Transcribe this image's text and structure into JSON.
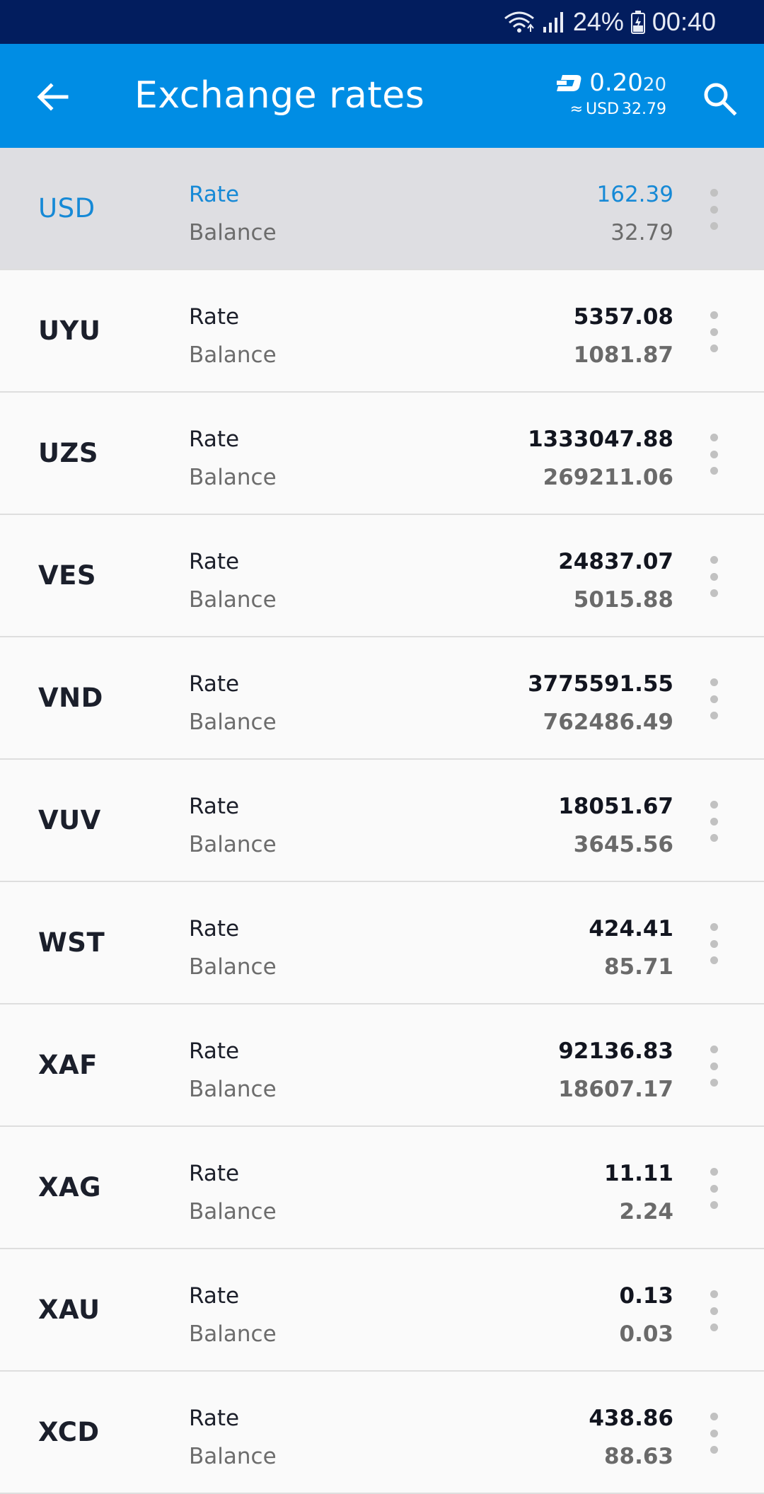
{
  "status": {
    "battery": "24%",
    "time": "00:40"
  },
  "header": {
    "title": "Exchange rates",
    "balance_int": "0.20",
    "balance_frac": "20",
    "approx": "≈",
    "fiat_code": "USD",
    "fiat_value": "32.79"
  },
  "labels": {
    "rate": "Rate",
    "balance": "Balance"
  },
  "rows": [
    {
      "code": "USD",
      "rate": "162.39",
      "balance": "32.79",
      "selected": true
    },
    {
      "code": "UYU",
      "rate": "5357.08",
      "balance": "1081.87"
    },
    {
      "code": "UZS",
      "rate": "1333047.88",
      "balance": "269211.06"
    },
    {
      "code": "VES",
      "rate": "24837.07",
      "balance": "5015.88"
    },
    {
      "code": "VND",
      "rate": "3775591.55",
      "balance": "762486.49"
    },
    {
      "code": "VUV",
      "rate": "18051.67",
      "balance": "3645.56"
    },
    {
      "code": "WST",
      "rate": "424.41",
      "balance": "85.71"
    },
    {
      "code": "XAF",
      "rate": "92136.83",
      "balance": "18607.17"
    },
    {
      "code": "XAG",
      "rate": "11.11",
      "balance": "2.24"
    },
    {
      "code": "XAU",
      "rate": "0.13",
      "balance": "0.03"
    },
    {
      "code": "XCD",
      "rate": "438.86",
      "balance": "88.63"
    }
  ],
  "colors": {
    "appbar": "#008de4",
    "statusbar": "#021d5e",
    "accent": "#1689d6"
  },
  "icons": {
    "back": "arrow-left-icon",
    "search": "search-icon",
    "currency": "dash-icon",
    "more": "more-vertical-icon"
  }
}
